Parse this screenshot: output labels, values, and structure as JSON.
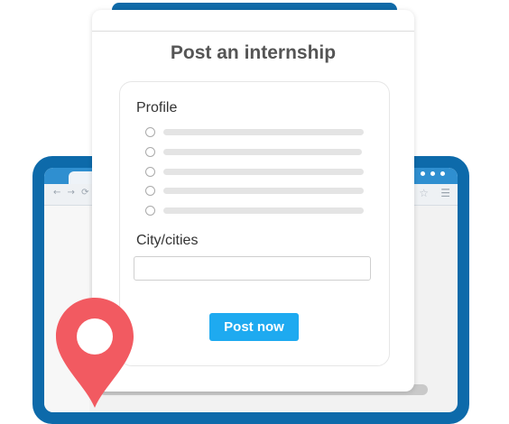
{
  "card": {
    "title": "Post an internship",
    "profile_label": "Profile",
    "city_label": "City/cities",
    "city_value": "",
    "post_button_label": "Post now"
  },
  "browser": {
    "nav_icons": "← → ⟳",
    "star_icon": "☆",
    "menu_icon": "☰"
  },
  "icons": {
    "location_pin": "location-pin-icon"
  },
  "colors": {
    "primary_blue": "#0d6aaa",
    "button_blue": "#1eaaf0",
    "pin_red": "#f25a61"
  }
}
